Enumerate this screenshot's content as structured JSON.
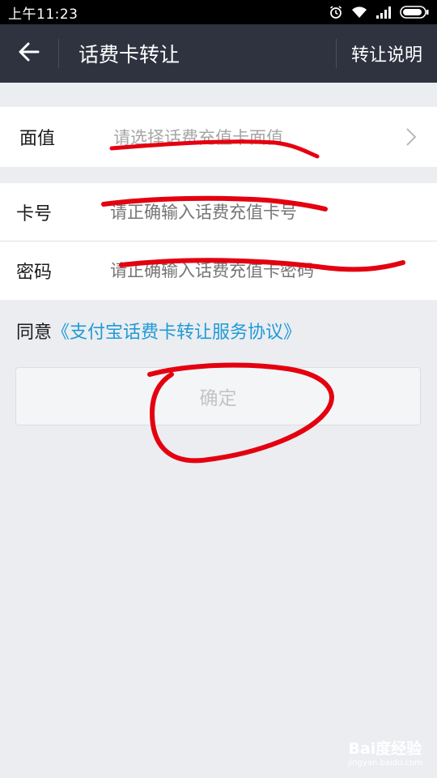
{
  "status_bar": {
    "time": "上午11:23",
    "icons": [
      "alarm-icon",
      "wifi-icon",
      "signal-icon",
      "battery-icon"
    ]
  },
  "header": {
    "title": "话费卡转让",
    "action": "转让说明",
    "back_icon": "back-arrow-icon"
  },
  "form": {
    "face_value": {
      "label": "面值",
      "placeholder": "请选择话费充值卡面值"
    },
    "card_number": {
      "label": "卡号",
      "placeholder": "请正确输入话费充值卡号"
    },
    "password": {
      "label": "密码",
      "placeholder": "请正确输入话费充值卡密码"
    }
  },
  "agreement": {
    "prefix": "同意",
    "link": "《支付宝话费卡转让服务协议》"
  },
  "confirm_label": "确定",
  "watermark": {
    "logo": "Bai度经验",
    "sub": "jingyan.baidu.com"
  },
  "colors": {
    "header_bg": "#2f3340",
    "link": "#1f9ad6",
    "annotation": "#e4000f",
    "page_bg": "#ebedf1"
  }
}
